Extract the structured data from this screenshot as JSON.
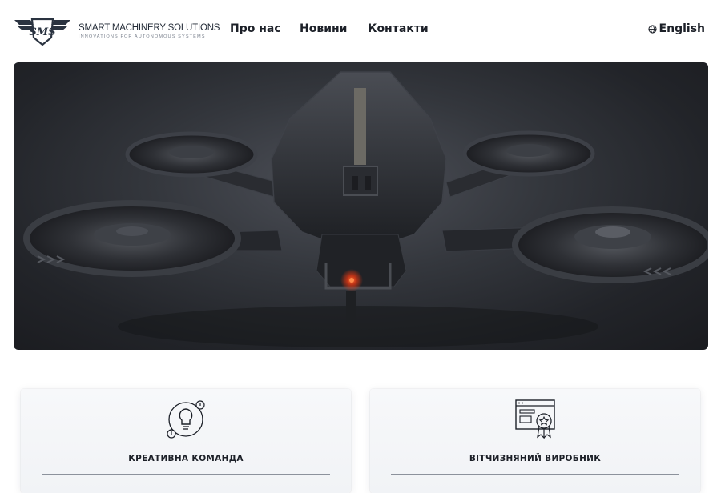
{
  "brand": {
    "title": "SMART MACHINERY SOLUTIONS",
    "tagline": "INNOVATIONS FOR AUTONOMOUS SYSTEMS"
  },
  "nav": {
    "items": [
      {
        "label": "Про нас"
      },
      {
        "label": "Новини"
      },
      {
        "label": "Контакти"
      }
    ],
    "language": "English"
  },
  "hero": {
    "image": "quadcopter-drone-render"
  },
  "features": [
    {
      "title": "КРЕАТИВНА КОМАНДА",
      "icon": "lightbulb-idea-icon"
    },
    {
      "title": "ВІТЧИЗНЯНИЙ ВИРОБНИК",
      "icon": "certified-browser-icon"
    }
  ],
  "colors": {
    "text": "#1c2028",
    "hero_dark": "#222429",
    "card_bg": "#f4f5f8",
    "drone_light": "#ff5a2a"
  }
}
